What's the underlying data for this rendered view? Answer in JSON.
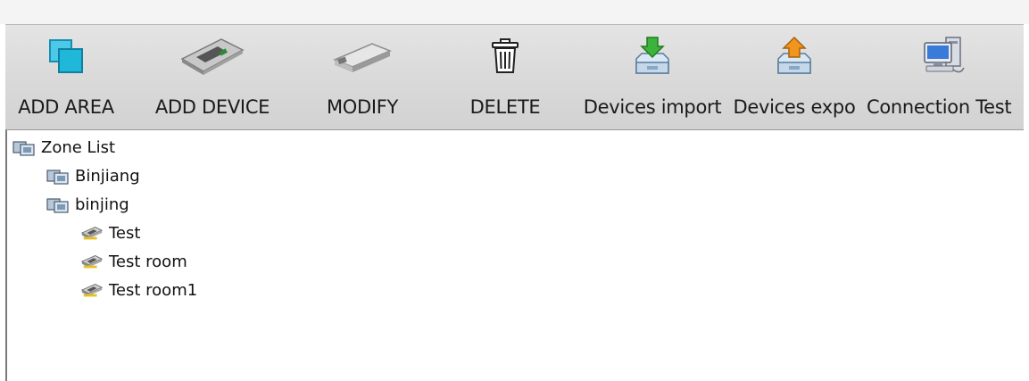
{
  "toolbar": {
    "buttons": [
      {
        "label": "ADD AREA",
        "icon": "add-area-icon"
      },
      {
        "label": "ADD DEVICE",
        "icon": "device-board-icon"
      },
      {
        "label": "MODIFY",
        "icon": "modify-icon"
      },
      {
        "label": "DELETE",
        "icon": "trash-icon"
      },
      {
        "label": "Devices import",
        "icon": "import-icon"
      },
      {
        "label": "Devices expo",
        "icon": "export-icon"
      },
      {
        "label": "Connection Test",
        "icon": "connection-test-icon"
      }
    ]
  },
  "tree": {
    "root": {
      "label": "Zone List",
      "icon": "zone-folder-icon"
    },
    "areas": [
      {
        "label": "Binjiang",
        "icon": "zone-folder-icon"
      },
      {
        "label": "binjing",
        "icon": "zone-folder-icon"
      }
    ],
    "devices": [
      {
        "label": "Test",
        "icon": "device-icon"
      },
      {
        "label": "Test room",
        "icon": "device-icon"
      },
      {
        "label": "Test room1",
        "icon": "device-icon"
      }
    ]
  },
  "colors": {
    "toolbar_bg": "#d9d9d9",
    "import_arrow": "#3cb43c",
    "export_arrow": "#f0961e",
    "add_area": "#1fb8d8"
  }
}
